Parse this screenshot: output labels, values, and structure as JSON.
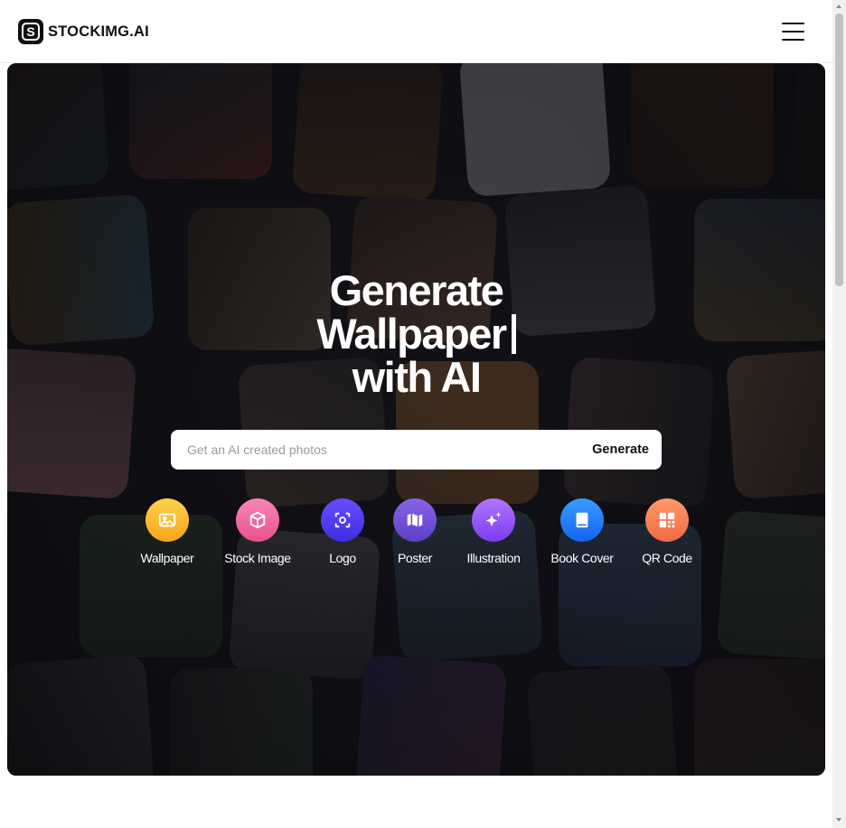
{
  "brand": {
    "name": "STOCKIMG.AI",
    "logo_letter": "S"
  },
  "header": {
    "menu_icon": "hamburger-menu-icon"
  },
  "hero": {
    "headline_line1": "Generate",
    "headline_line2": "Wallpaper",
    "headline_line3": "with AI"
  },
  "search": {
    "placeholder": "Get an AI created photos",
    "value": "",
    "button_label": "Generate"
  },
  "categories": [
    {
      "label": "Wallpaper",
      "icon": "image-icon",
      "color_from": "#ffd24a",
      "color_to": "#f7a51c"
    },
    {
      "label": "Stock Image",
      "icon": "box-icon",
      "color_from": "#f986b8",
      "color_to": "#ec4f8f"
    },
    {
      "label": "Logo",
      "icon": "focus-scan-icon",
      "color_from": "#6a4cff",
      "color_to": "#3b2fe0"
    },
    {
      "label": "Poster",
      "icon": "map-icon",
      "color_from": "#8a62e8",
      "color_to": "#5e3fc9"
    },
    {
      "label": "Illustration",
      "icon": "sparkles-icon",
      "color_from": "#b276ff",
      "color_to": "#7a3cf0"
    },
    {
      "label": "Book Cover",
      "icon": "book-icon",
      "color_from": "#3a9cff",
      "color_to": "#1464f0"
    },
    {
      "label": "QR Code",
      "icon": "qr-code-icon",
      "color_from": "#ff9a6a",
      "color_to": "#f26a45"
    }
  ]
}
